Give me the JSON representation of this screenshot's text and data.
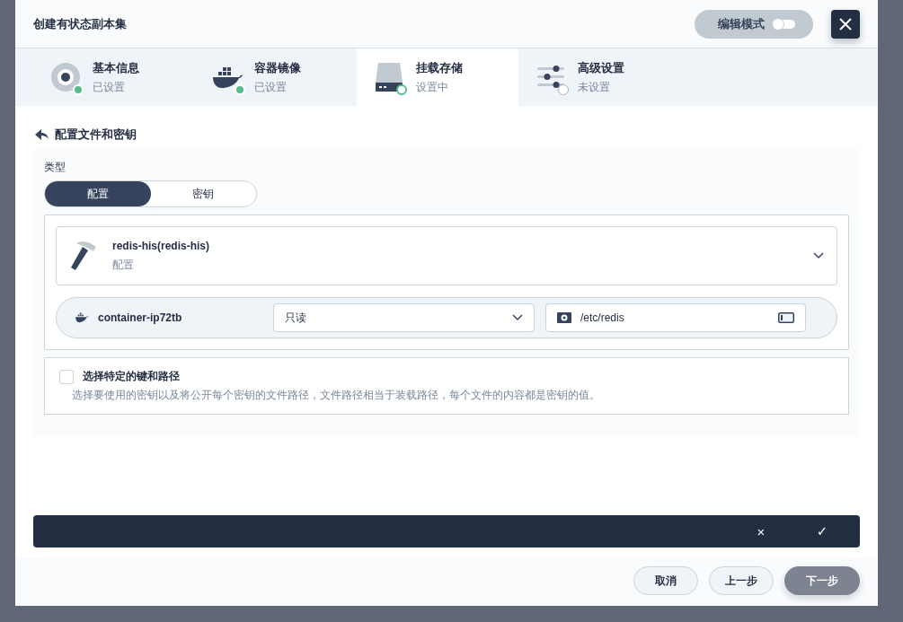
{
  "dialog": {
    "title": "创建有状态副本集",
    "edit_mode": {
      "label": "编辑模式",
      "on": false
    }
  },
  "steps": [
    {
      "title": "基本信息",
      "status_text": "已设置",
      "kind": "info",
      "complete": true,
      "selected": false
    },
    {
      "title": "容器镜像",
      "status_text": "已设置",
      "kind": "image",
      "complete": true,
      "selected": false
    },
    {
      "title": "挂载存储",
      "status_text": "设置中",
      "kind": "storage",
      "complete": false,
      "selected": true
    },
    {
      "title": "高级设置",
      "status_text": "未设置",
      "kind": "advanced",
      "complete": false,
      "selected": false
    }
  ],
  "section": {
    "title": "配置文件和密钥"
  },
  "type_field": {
    "label": "类型",
    "options": [
      {
        "label": "配置",
        "selected": true
      },
      {
        "label": "密钥",
        "selected": false
      }
    ]
  },
  "resource": {
    "name": "redis-his(redis-his)",
    "type": "配置"
  },
  "mount": {
    "container": "container-ip72tb",
    "access_mode": "只读",
    "path": "/etc/redis"
  },
  "specific_keys": {
    "label": "选择特定的键和路径",
    "description": "选择要使用的密钥以及将公开每个密钥的文件路径，文件路径相当于装载路径，每个文件的内容都是密钥的值。",
    "checked": false
  },
  "confirm_bar": {
    "cancel": "×",
    "confirm": "✓"
  },
  "footer_buttons": [
    {
      "label": "取消",
      "kind": "secondary"
    },
    {
      "label": "上一步",
      "kind": "secondary"
    },
    {
      "label": "下一步",
      "kind": "primary"
    }
  ]
}
